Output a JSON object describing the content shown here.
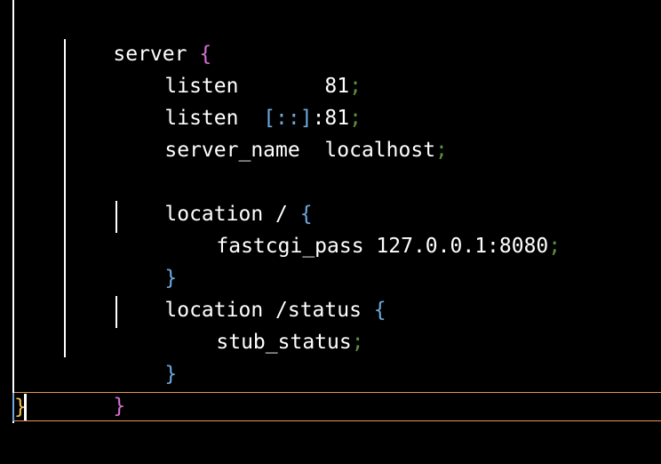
{
  "editor": {
    "lines": [
      {
        "kw": "server",
        "brace": "{"
      },
      {
        "kw": "listen",
        "gap": "       ",
        "value": "81",
        "semi": ";"
      },
      {
        "kw": "listen",
        "gap": "  ",
        "ipv6": "[::]",
        "value": ":81",
        "semi": ";"
      },
      {
        "kw": "server_name",
        "gap": "  ",
        "value": "localhost",
        "semi": ";"
      },
      {
        "kw": "location",
        "path": " / ",
        "brace": "{"
      },
      {
        "kw": "fastcgi_pass",
        "gap": " ",
        "value": "127.0.0.1:8080",
        "semi": ";"
      },
      {
        "brace": "}"
      },
      {
        "kw": "location",
        "path": " /status ",
        "brace": "{"
      },
      {
        "kw": "stub_status",
        "semi": ";"
      },
      {
        "brace": "}"
      },
      {
        "brace": "}"
      },
      {
        "brace": "}"
      }
    ]
  },
  "colors": {
    "background": "#000000",
    "text": "#ffffff",
    "brace_server": "#d670d6",
    "brace_location": "#6fa8dc",
    "semicolon": "#5f8f3f",
    "brace_outer": "#f2c14e",
    "current_line_border": "#e8935a"
  }
}
